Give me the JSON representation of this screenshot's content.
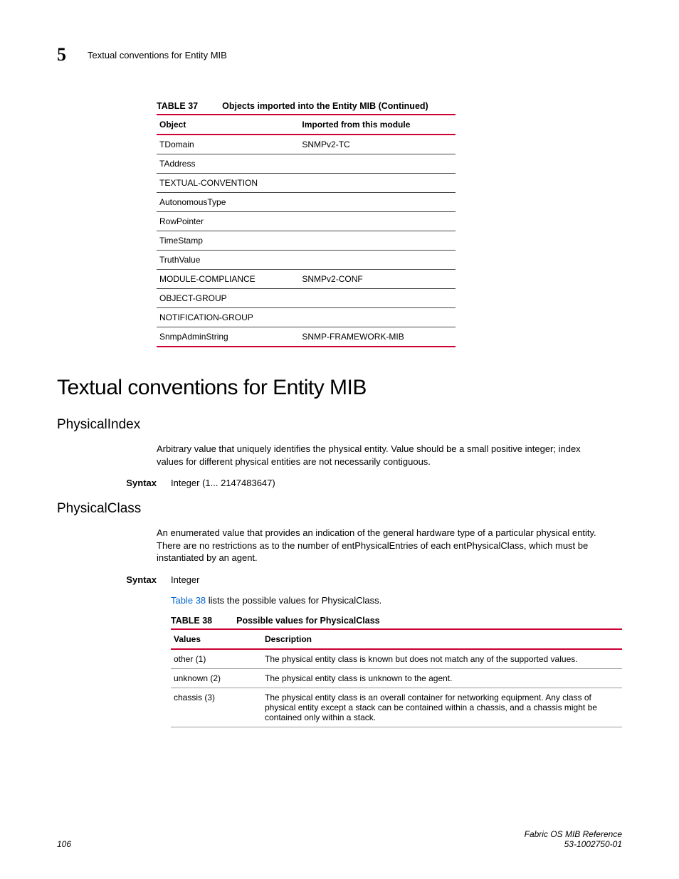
{
  "header": {
    "chapter_number": "5",
    "running_title": "Textual conventions for Entity MIB"
  },
  "table37": {
    "number": "TABLE 37",
    "title": "Objects imported into the Entity MIB (Continued)",
    "col1": "Object",
    "col2": "Imported from this module",
    "rows": [
      {
        "obj": "TDomain",
        "mod": "SNMPv2-TC"
      },
      {
        "obj": "TAddress",
        "mod": ""
      },
      {
        "obj": "TEXTUAL-CONVENTION",
        "mod": ""
      },
      {
        "obj": "AutonomousType",
        "mod": ""
      },
      {
        "obj": "RowPointer",
        "mod": ""
      },
      {
        "obj": "TimeStamp",
        "mod": ""
      },
      {
        "obj": "TruthValue",
        "mod": ""
      },
      {
        "obj": "MODULE-COMPLIANCE",
        "mod": "SNMPv2-CONF"
      },
      {
        "obj": "OBJECT-GROUP",
        "mod": ""
      },
      {
        "obj": "NOTIFICATION-GROUP",
        "mod": ""
      },
      {
        "obj": "SnmpAdminString",
        "mod": "SNMP-FRAMEWORK-MIB"
      }
    ]
  },
  "section_title": "Textual conventions for Entity MIB",
  "physical_index": {
    "heading": "PhysicalIndex",
    "body": "Arbitrary value that uniquely identifies the physical entity. Value should be a small positive integer; index values for different physical entities are not necessarily contiguous.",
    "syntax_label": "Syntax",
    "syntax_value": "Integer (1... 2147483647)"
  },
  "physical_class": {
    "heading": "PhysicalClass",
    "body": "An enumerated value that provides an indication of the general hardware type of a particular physical entity. There are no restrictions as to the number of entPhysicalEntries of each entPhysicalClass, which must be instantiated by an agent.",
    "syntax_label": "Syntax",
    "syntax_value": "Integer",
    "xref_link": "Table 38",
    "xref_rest": " lists the possible values for PhysicalClass."
  },
  "table38": {
    "number": "TABLE 38",
    "title": "Possible values for PhysicalClass",
    "col1": "Values",
    "col2": "Description",
    "rows": [
      {
        "v": "other (1)",
        "d": "The physical entity class is known but does not match any of the supported values."
      },
      {
        "v": "unknown (2)",
        "d": "The physical entity class is unknown to the agent."
      },
      {
        "v": "chassis (3)",
        "d": "The physical entity class is an overall container for networking equipment. Any class of physical entity except a stack can be contained within a chassis, and a chassis might be contained only within a stack."
      }
    ]
  },
  "footer": {
    "page": "106",
    "doc_title": "Fabric OS MIB Reference",
    "doc_number": "53-1002750-01"
  }
}
